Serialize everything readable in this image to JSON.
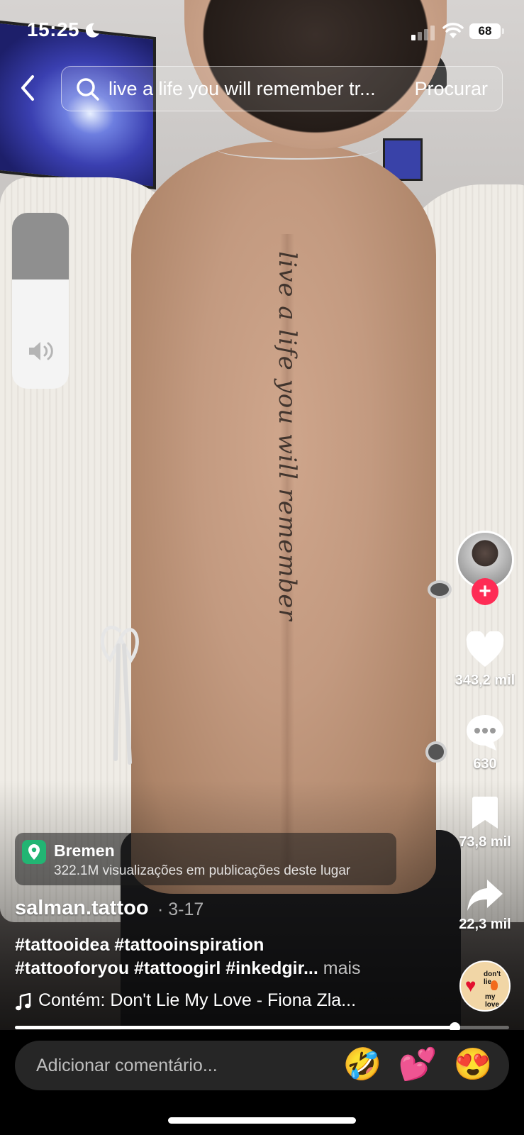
{
  "status_bar": {
    "time": "15:25",
    "battery": "68"
  },
  "search": {
    "query": "live a life you will remember tr...",
    "button_label": "Procurar"
  },
  "video": {
    "tattoo_text": "live a life you will remember"
  },
  "volume": {
    "level": 0.62
  },
  "rail": {
    "likes": "343,2 mil",
    "comments": "630",
    "saves": "73,8 mil",
    "shares": "22,3 mil",
    "follow_symbol": "+",
    "disc_text_top": "don't lie",
    "disc_text_bottom": "my love"
  },
  "location": {
    "name": "Bremen",
    "subtitle": "322.1M visualizações em publicações deste lugar"
  },
  "post": {
    "username": "salman.tattoo",
    "date": "· 3-17",
    "caption_line1": "#tattooidea #tattooinspiration",
    "caption_line2": "#tattooforyou #tattoogirl #inkedgir...",
    "more": " mais",
    "music": "Contém: Don't Lie My Love - Fiona Zla..."
  },
  "progress": {
    "fraction": 0.89
  },
  "comment": {
    "placeholder": "Adicionar comentário...",
    "emojis": [
      "🤣",
      "💕",
      "😍"
    ]
  }
}
